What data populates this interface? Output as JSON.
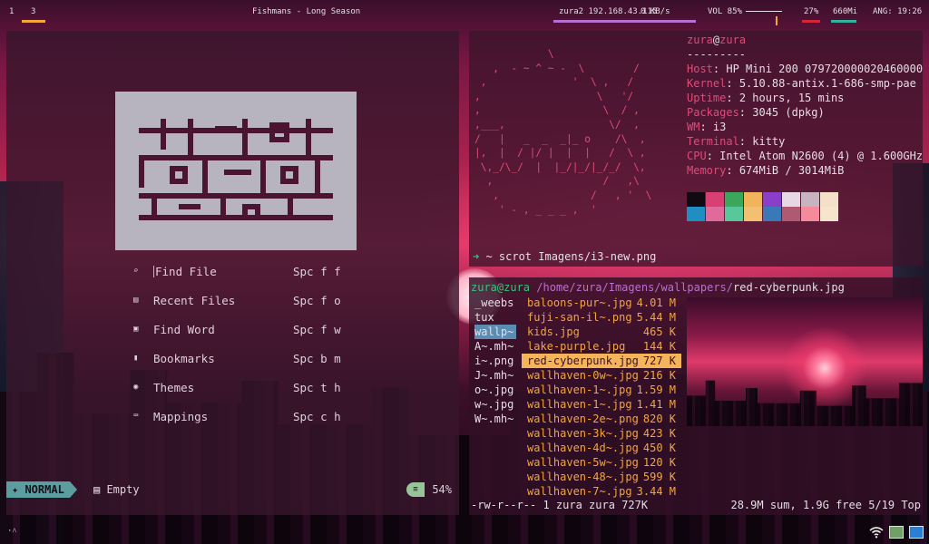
{
  "topbar": {
    "workspaces": [
      "1",
      "3"
    ],
    "title": "Fishmans - Long Season",
    "network": "zura2 192.168.43.115",
    "speed": "0 KB/s",
    "volume_label": "VOL 85%",
    "volume_level": 0.85,
    "cpu": "27%",
    "memory": "660Mi",
    "time": "ANG: 19:26"
  },
  "nvim": {
    "menu": [
      {
        "icon": "search-icon",
        "glyph": "⌕",
        "label": "Find File",
        "key": "Spc f f"
      },
      {
        "icon": "file-icon",
        "glyph": "▤",
        "label": "Recent Files",
        "key": "Spc f o"
      },
      {
        "icon": "word-icon",
        "glyph": "▣",
        "label": "Find Word",
        "key": "Spc f w"
      },
      {
        "icon": "bookmark-icon",
        "glyph": "▮",
        "label": "Bookmarks",
        "key": "Spc b m"
      },
      {
        "icon": "palette-icon",
        "glyph": "◉",
        "label": "Themes",
        "key": "Spc t h"
      },
      {
        "icon": "keyboard-icon",
        "glyph": "⌨",
        "label": "Mappings",
        "key": "Spc c h"
      }
    ],
    "status": {
      "mode": "NORMAL",
      "buffer": "Empty",
      "percent": "54%"
    }
  },
  "neofetch": {
    "ascii": "            \\\n   ,  - ~ ^ ~ -  \\        /\n ,              '  \\ ,   /\n,                   \\   '/\n,                    \\  / ,\n,___,                 \\/  ,\n/   |   _  _  _|_ o    /\\  ,\n|,  |  / |/ |  |  |   /  \\ ,\n \\,_/\\_/  |  |_/|_/|_/_/  \\,\n  ,                  /   ,\\\n   ,               /   , '  \\\n    ' - , _ _ _ ,  '",
    "user": "zura",
    "host": "zura",
    "separator": "---------",
    "info": [
      {
        "key": "Host",
        "value": "HP Mini 200 079720000020460000"
      },
      {
        "key": "Kernel",
        "value": "5.10.88-antix.1-686-smp-pae"
      },
      {
        "key": "Uptime",
        "value": "2 hours, 15 mins"
      },
      {
        "key": "Packages",
        "value": "3045 (dpkg)"
      },
      {
        "key": "WM",
        "value": "i3"
      },
      {
        "key": "Terminal",
        "value": "kitty"
      },
      {
        "key": "CPU",
        "value": "Intel Atom N2600 (4) @ 1.600GHz"
      },
      {
        "key": "Memory",
        "value": "674MiB / 3014MiB"
      }
    ],
    "palette": [
      "#120a12",
      "#d83f72",
      "#3aa75a",
      "#f2b45a",
      "#8a3fc8",
      "#e6d8e4",
      "#c8b4c0",
      "#f4e0c8",
      "#1f8ec2",
      "#e06a9c",
      "#58c79a",
      "#f2c070",
      "#3a78b8",
      "#b05a72",
      "#f48a9a",
      "#f6e4cc"
    ],
    "command": "~ scrot Imagens/i3-new.png"
  },
  "ranger": {
    "user": "zura@zura",
    "path": "/home/zura/Imagens/wallpapers/",
    "file": "red-cyberpunk.jpg",
    "parent": [
      "_weebs",
      "tux",
      "wallp~",
      "A~.mh~",
      "i~.png",
      "J~.mh~",
      "o~.jpg",
      "w~.jpg",
      "W~.mh~"
    ],
    "files": [
      {
        "name": "baloons-pur~.jpg",
        "size": "4.01 M"
      },
      {
        "name": "fuji-san-il~.png",
        "size": "5.44 M"
      },
      {
        "name": "kids.jpg",
        "size": "465 K"
      },
      {
        "name": "lake-purple.jpg",
        "size": "144 K"
      },
      {
        "name": "red-cyberpunk.jpg",
        "size": "727 K"
      },
      {
        "name": "wallhaven-0w~.jpg",
        "size": "216 K"
      },
      {
        "name": "wallhaven-1~.jpg",
        "size": "1.59 M"
      },
      {
        "name": "wallhaven-1~.jpg",
        "size": "1.41 M"
      },
      {
        "name": "wallhaven-2e~.png",
        "size": "820 K"
      },
      {
        "name": "wallhaven-3k~.jpg",
        "size": "423 K"
      },
      {
        "name": "wallhaven-4d~.jpg",
        "size": "450 K"
      },
      {
        "name": "wallhaven-5w~.jpg",
        "size": "120 K"
      },
      {
        "name": "wallhaven-48~.jpg",
        "size": "599 K"
      },
      {
        "name": "wallhaven-7~.jpg",
        "size": "3.44 M"
      }
    ],
    "footer_left": "-rw-r--r-- 1 zura zura 727K",
    "footer_right": "28.9M sum, 1.9G free  5/19  Top"
  },
  "tray": {
    "left": "·˄"
  }
}
